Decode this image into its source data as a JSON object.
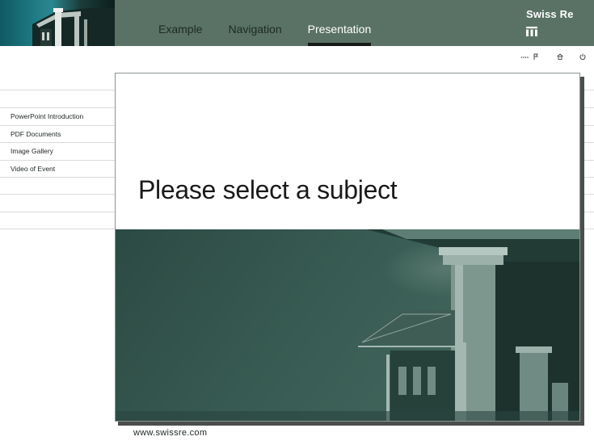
{
  "header": {
    "nav": [
      "Example",
      "Navigation",
      "Presentation"
    ],
    "active_nav": "Presentation",
    "brand": "Swiss Re"
  },
  "util_icons": [
    "ellipsis-icon",
    "flag-icon",
    "home-icon",
    "power-icon"
  ],
  "sidebar": {
    "items": [
      {
        "label": "PowerPoint Introduction"
      },
      {
        "label": "PDF Documents"
      },
      {
        "label": "Image Gallery"
      },
      {
        "label": "Video of Event"
      }
    ]
  },
  "main": {
    "heading": "Please select a subject"
  },
  "footer": {
    "url": "www.swissre.com"
  },
  "colors": {
    "header_bg": "#5a7266",
    "image_tint": "#31504a",
    "active_underline": "#151a18"
  }
}
